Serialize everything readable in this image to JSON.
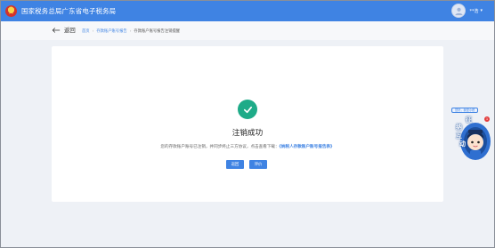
{
  "header": {
    "title": "国家税务总局广东省电子税务局",
    "user_name": "**浩"
  },
  "nav": {
    "back_label": "返回",
    "breadcrumbs": [
      "首页",
      "存款账户账号报告",
      "存款账户账号报告注销提醒"
    ]
  },
  "result": {
    "title": "注销成功",
    "description": "您的存款账户账号已注销，并同步终止三方协议，点击查看下载：",
    "report_link": "《纳税人存款账户账号报告表》",
    "buttons": {
      "back": "返回",
      "review": "评价"
    }
  },
  "assistant": {
    "tag": "您好，我是小税",
    "badge": "1",
    "label_chars": [
      "征",
      "纳",
      "互",
      "动"
    ]
  },
  "colors": {
    "primary": "#3f83e3",
    "success": "#1eab88",
    "badge": "#e33d3d"
  }
}
